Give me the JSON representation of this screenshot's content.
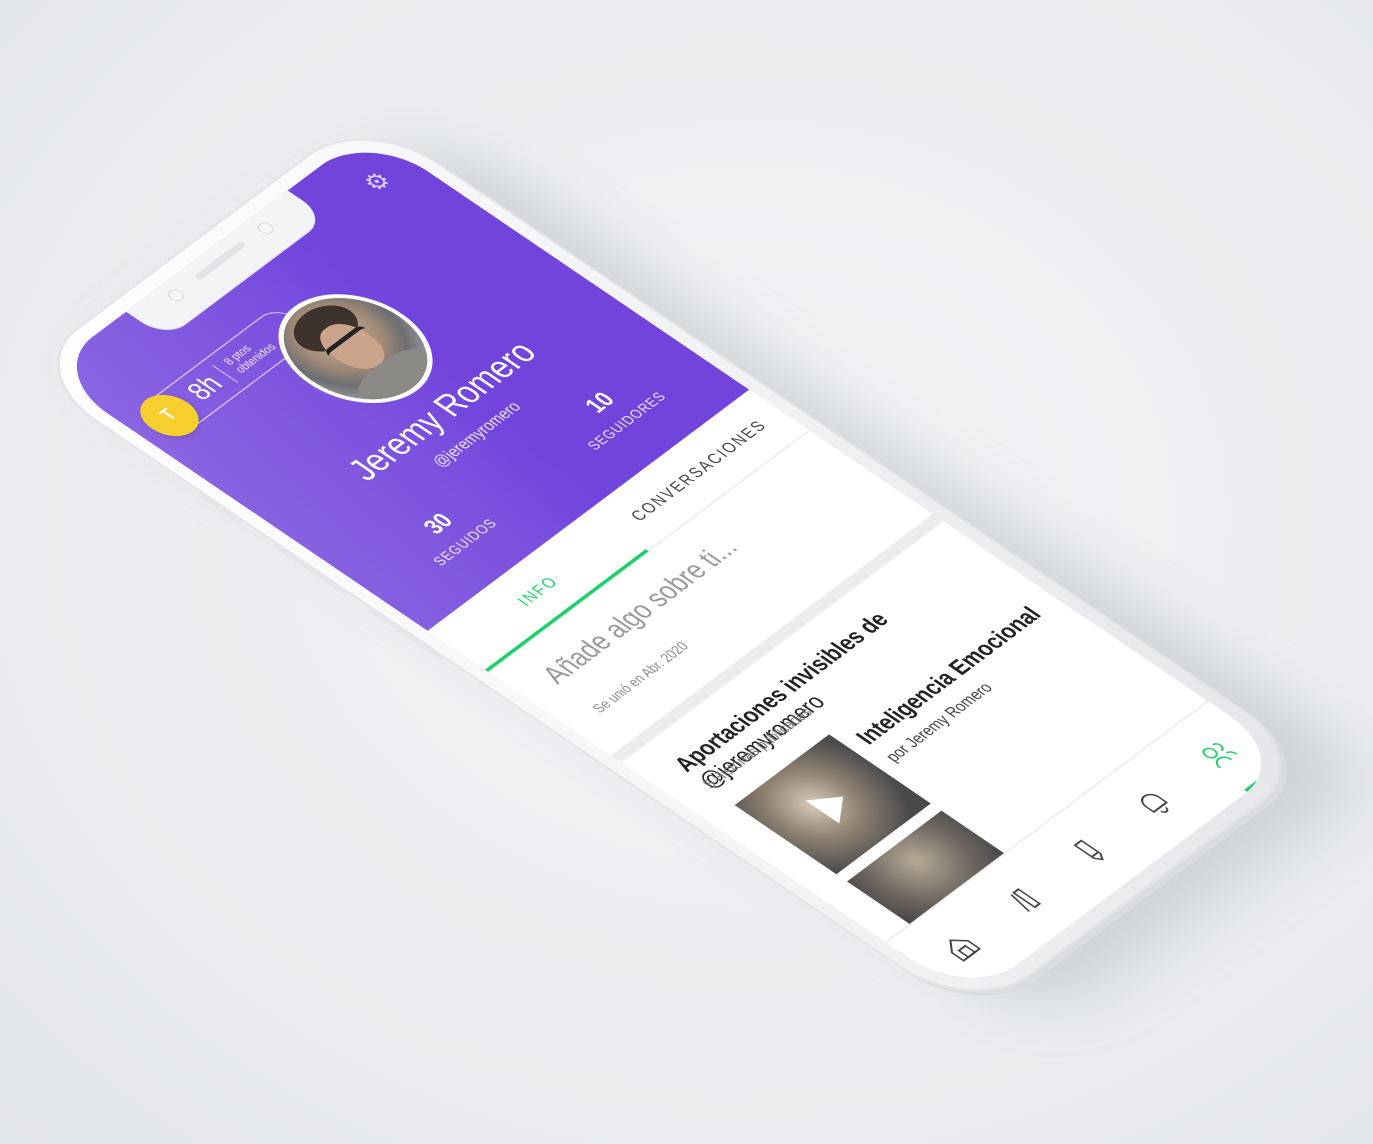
{
  "header": {
    "avatar_letter": "T",
    "hours": "8h",
    "points_label": "8 ptos obtenidos",
    "accent_color": "#7244dc"
  },
  "profile": {
    "name": "Jeremy Romero",
    "handle": "@jeremyromero",
    "stats": [
      {
        "value": "30",
        "label": "SEGUIDOS"
      },
      {
        "value": "10",
        "label": "SEGUIDORES"
      }
    ]
  },
  "tabs": [
    {
      "label": "INFO",
      "active": true
    },
    {
      "label": "CONVERSACIONES",
      "active": false
    }
  ],
  "info": {
    "prompt": "Añade algo sobre ti...",
    "joined": "Se unió en Abr. 2020"
  },
  "contributions": {
    "title_prefix": "Aportaciones invisibles de",
    "title_handle": "@jeremyromero",
    "subtitle": "5 Historias publicadas",
    "story": {
      "title": "Inteligencia Emocional",
      "author": "por Jeremy Romero"
    }
  },
  "bottom_nav": [
    {
      "icon": "home-icon",
      "active": false
    },
    {
      "icon": "library-icon",
      "active": false
    },
    {
      "icon": "pencil-icon",
      "active": false
    },
    {
      "icon": "bell-icon",
      "active": false
    },
    {
      "icon": "profile-icon",
      "active": true
    }
  ],
  "colors": {
    "primary": "#7244dc",
    "active_green": "#20d06a",
    "badge_yellow": "#f6cf2f"
  }
}
